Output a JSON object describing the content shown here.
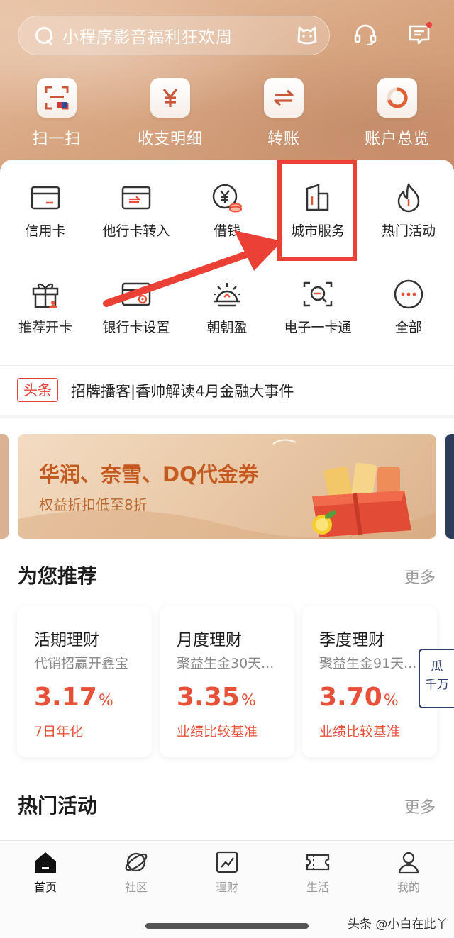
{
  "search": {
    "placeholder": "小程序影音福利狂欢周"
  },
  "header_icons": [
    "cat-mascot-icon",
    "headset-icon",
    "message-icon"
  ],
  "quick_actions": [
    {
      "label": "扫一扫",
      "icon": "scan-icon"
    },
    {
      "label": "收支明细",
      "icon": "yen-statement-icon"
    },
    {
      "label": "转账",
      "icon": "transfer-icon"
    },
    {
      "label": "账户总览",
      "icon": "account-ring-icon"
    }
  ],
  "services": [
    {
      "label": "信用卡",
      "icon": "credit-card-icon"
    },
    {
      "label": "他行卡转入",
      "icon": "card-transfer-in-icon"
    },
    {
      "label": "借钱",
      "icon": "loan-icon"
    },
    {
      "label": "城市服务",
      "icon": "city-service-icon"
    },
    {
      "label": "热门活动",
      "icon": "flame-icon"
    },
    {
      "label": "推荐开卡",
      "icon": "gift-icon"
    },
    {
      "label": "银行卡设置",
      "icon": "card-settings-icon"
    },
    {
      "label": "朝朝盈",
      "icon": "sunrise-icon"
    },
    {
      "label": "电子一卡通",
      "icon": "e-card-icon"
    },
    {
      "label": "全部",
      "icon": "more-dots-icon"
    }
  ],
  "headline": {
    "tag": "头条",
    "text": "招牌播客|香帅解读4月金融大事件"
  },
  "banner": {
    "title": "华润、奈雪、DQ代金券",
    "subtitle": "权益折扣低至8折"
  },
  "recommend": {
    "title": "为您推荐",
    "more": "更多",
    "cards": [
      {
        "title": "活期理财",
        "subtitle": "代销招赢开鑫宝",
        "rate": "3.17",
        "unit": "%",
        "note": "7日年化"
      },
      {
        "title": "月度理财",
        "subtitle": "聚益生金30天...",
        "rate": "3.35",
        "unit": "%",
        "note": "业绩比较基准"
      },
      {
        "title": "季度理财",
        "subtitle": "聚益生金91天...",
        "rate": "3.70",
        "unit": "%",
        "note": "业绩比较基准"
      }
    ],
    "side_tab": [
      "瓜",
      "千万"
    ]
  },
  "hot": {
    "title": "热门活动",
    "more": "更多"
  },
  "tabs": [
    {
      "label": "首页",
      "icon": "home-icon",
      "active": true
    },
    {
      "label": "社区",
      "icon": "planet-icon",
      "active": false
    },
    {
      "label": "理财",
      "icon": "chart-icon",
      "active": false
    },
    {
      "label": "生活",
      "icon": "ticket-icon",
      "active": false
    },
    {
      "label": "我的",
      "icon": "person-icon",
      "active": false
    }
  ],
  "watermark": "头条 @小白在此丫",
  "colors": {
    "accent_red": "#ea4036",
    "rate_red": "#e8503a",
    "hero": "#d9a783"
  }
}
